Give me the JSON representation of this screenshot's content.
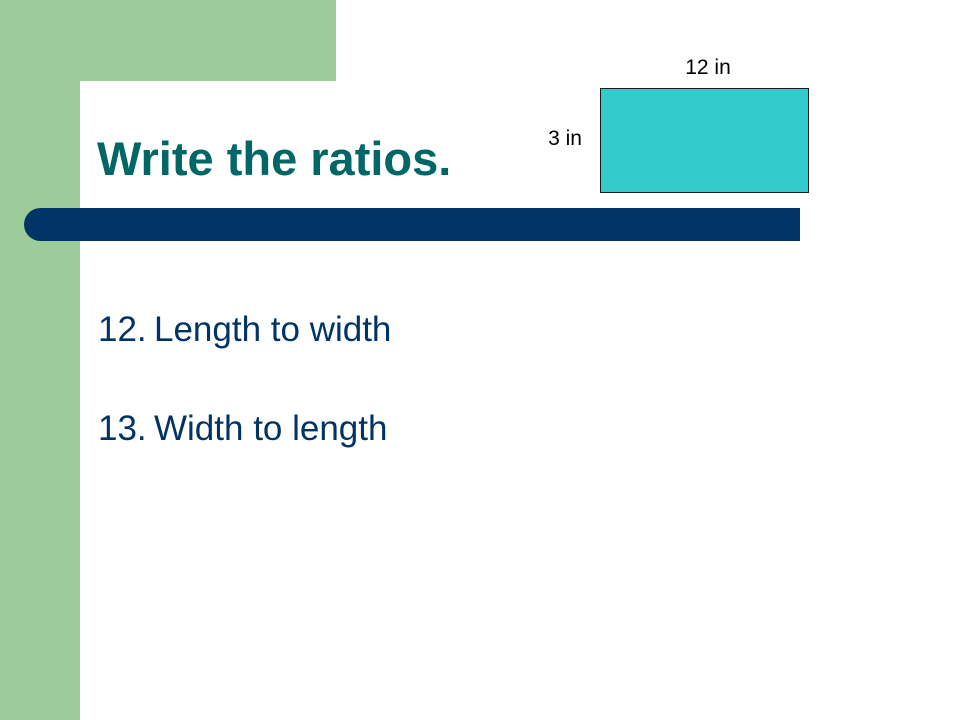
{
  "slide": {
    "title": "Write the ratios.",
    "figure": {
      "length_label": "12 in",
      "width_label": "3 in",
      "fill_color": "#33cccc"
    },
    "items": [
      {
        "number": "12.",
        "text": "Length to width"
      },
      {
        "number": "13.",
        "text": "Width to length"
      }
    ]
  },
  "theme": {
    "accent_green": "#9ccc99",
    "title_color": "#006666",
    "bar_color": "#003366",
    "text_color": "#003366"
  }
}
